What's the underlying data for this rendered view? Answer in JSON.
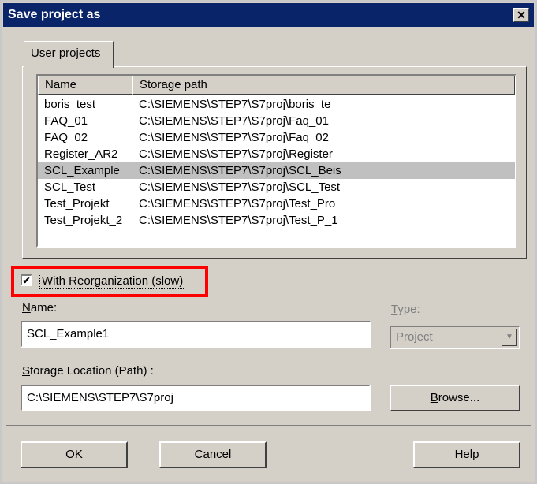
{
  "window": {
    "title": "Save project as"
  },
  "tabs": [
    {
      "label": "User projects"
    }
  ],
  "list": {
    "columns": [
      "Name",
      "Storage path"
    ],
    "rows": [
      {
        "name": "boris_test",
        "path": "C:\\SIEMENS\\STEP7\\S7proj\\boris_te"
      },
      {
        "name": "FAQ_01",
        "path": "C:\\SIEMENS\\STEP7\\S7proj\\Faq_01"
      },
      {
        "name": "FAQ_02",
        "path": "C:\\SIEMENS\\STEP7\\S7proj\\Faq_02"
      },
      {
        "name": "Register_AR2",
        "path": "C:\\SIEMENS\\STEP7\\S7proj\\Register"
      },
      {
        "name": "SCL_Example",
        "path": "C:\\SIEMENS\\STEP7\\S7proj\\SCL_Beis"
      },
      {
        "name": "SCL_Test",
        "path": "C:\\SIEMENS\\STEP7\\S7proj\\SCL_Test"
      },
      {
        "name": "Test_Projekt",
        "path": "C:\\SIEMENS\\STEP7\\S7proj\\Test_Pro"
      },
      {
        "name": "Test_Projekt_2",
        "path": "C:\\SIEMENS\\STEP7\\S7proj\\Test_P_1"
      }
    ],
    "selected_index": 4
  },
  "reorg": {
    "label": "With Reorganization (slow)",
    "checked": true
  },
  "name_field": {
    "label_first": "N",
    "label_rest": "ame:",
    "value": "SCL_Example1"
  },
  "type_field": {
    "label_first": "T",
    "label_rest": "ype:",
    "value": "Project"
  },
  "location_field": {
    "label_first": "S",
    "label_rest": "torage Location (Path) :",
    "value": "C:\\SIEMENS\\STEP7\\S7proj"
  },
  "buttons": {
    "browse_first": "B",
    "browse_rest": "rowse...",
    "ok": "OK",
    "cancel": "Cancel",
    "help": "Help"
  }
}
